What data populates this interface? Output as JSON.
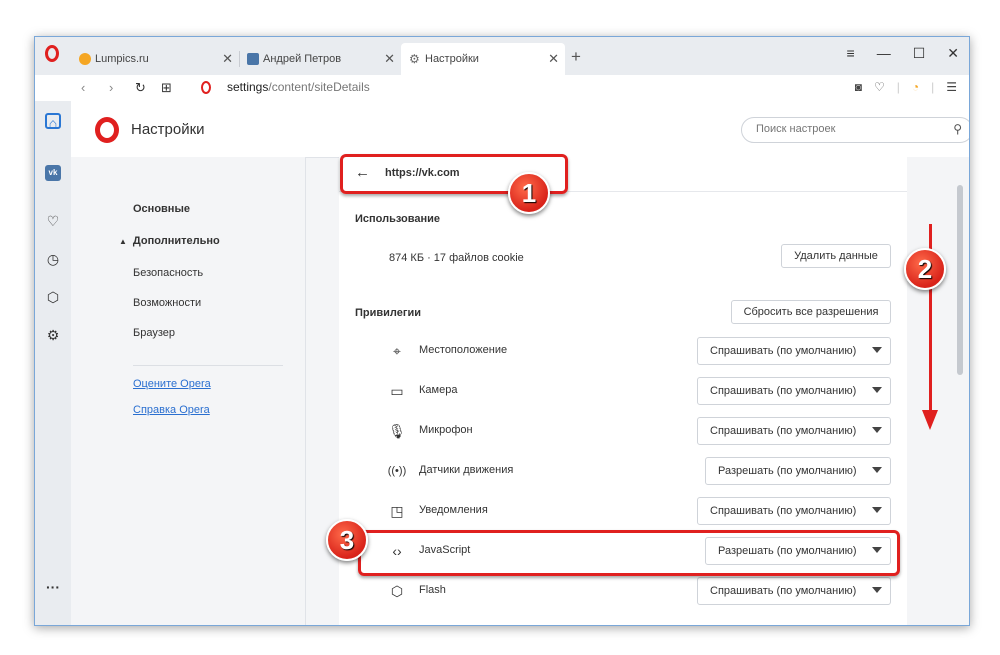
{
  "tabs": [
    {
      "label": "Lumpics.ru",
      "favicon_color": "#f5a623"
    },
    {
      "label": "Андрей Петров",
      "favicon_color": "#4a76a8"
    },
    {
      "label": "Настройки",
      "favicon_color": "#777777"
    }
  ],
  "address": {
    "host": "settings",
    "path": "/content/siteDetails"
  },
  "header": {
    "title": "Настройки",
    "search_placeholder": "Поиск настроек"
  },
  "nav": {
    "main": "Основные",
    "advanced": "Дополнительно",
    "security": "Безопасность",
    "features": "Возможности",
    "browser": "Браузер",
    "rate": "Оцените Opera",
    "help": "Справка Opera"
  },
  "site": {
    "url": "https://vk.com"
  },
  "usage": {
    "title": "Использование",
    "text": "874 КБ · 17 файлов cookie",
    "clear_button": "Удалить данные"
  },
  "privileges": {
    "title": "Привилегии",
    "reset_button": "Сбросить все разрешения",
    "items": [
      {
        "label": "Местоположение",
        "value": "Спрашивать (по умолчанию)"
      },
      {
        "label": "Камера",
        "value": "Спрашивать (по умолчанию)"
      },
      {
        "label": "Микрофон",
        "value": "Спрашивать (по умолчанию)"
      },
      {
        "label": "Датчики движения",
        "value": "Разрешать (по умолчанию)"
      },
      {
        "label": "Уведомления",
        "value": "Спрашивать (по умолчанию)"
      },
      {
        "label": "JavaScript",
        "value": "Разрешать (по умолчанию)"
      },
      {
        "label": "Flash",
        "value": "Спрашивать (по умолчанию)"
      }
    ]
  },
  "annotations": {
    "badge1": "1",
    "badge2": "2",
    "badge3": "3"
  },
  "colors": {
    "accent": "#e0201f",
    "link": "#2a6fd0"
  }
}
